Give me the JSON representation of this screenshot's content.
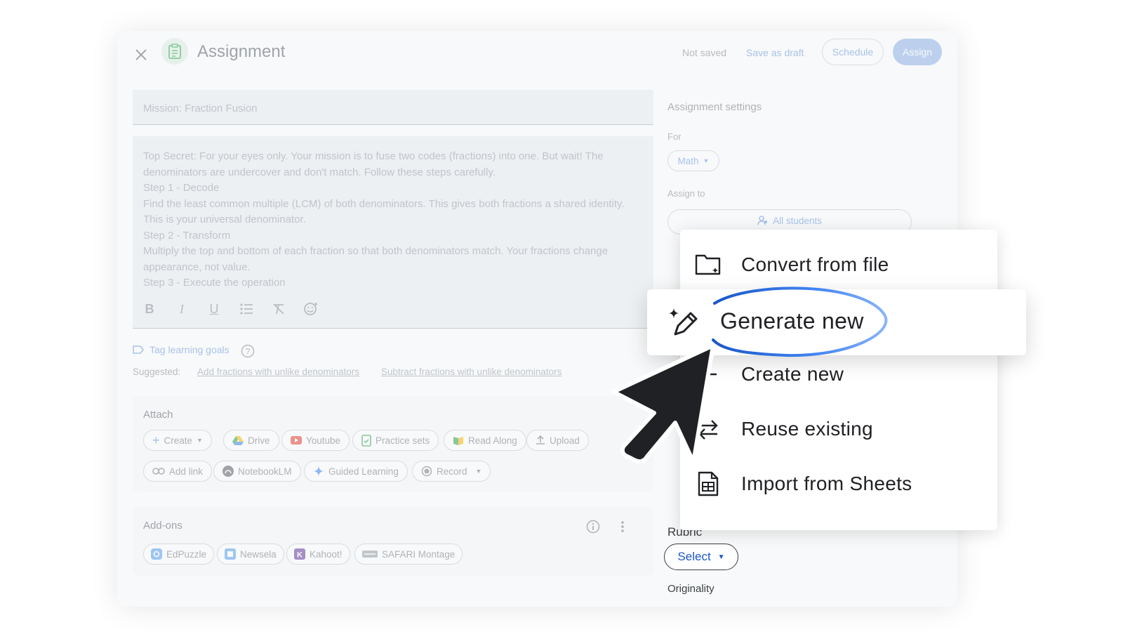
{
  "header": {
    "title": "Assignment",
    "status": "Not saved",
    "save_draft": "Save as draft",
    "schedule": "Schedule",
    "assign": "Assign"
  },
  "form": {
    "title_value": "Mission: Fraction Fusion",
    "description_lines": [
      "Top Secret: For your eyes only. Your mission is to fuse two codes (fractions) into one. But wait! The",
      "denominators are undercover and don't match. Follow these steps carefully.",
      "Step 1 - Decode",
      "Find the least common multiple (LCM) of both denominators. This gives both fractions a shared identity.",
      "This is your universal denominator.",
      "Step 2 - Transform",
      "Multiply the top and bottom of each fraction so that both denominators match. Your fractions change",
      "appearance, not value.",
      "Step 3 - Execute the operation"
    ],
    "toolbar": [
      "bold-icon",
      "italic-icon",
      "underline-icon",
      "bulleted-list-icon",
      "clear-format-icon",
      "emoji-icon"
    ]
  },
  "learning_goals": {
    "tag_label": "Tag learning goals",
    "suggested_label": "Suggested:",
    "suggestions": [
      "Add fractions with unlike denominators",
      "Subtract fractions with unlike denominators"
    ]
  },
  "attach": {
    "title": "Attach",
    "chips": [
      "Create",
      "Drive",
      "Youtube",
      "Practice sets",
      "Read Along",
      "Upload",
      "Add link",
      "NotebookLM",
      "Guided Learning",
      "Record"
    ]
  },
  "addons": {
    "title": "Add-ons",
    "chips": [
      "EdPuzzle",
      "Newsela",
      "Kahoot!",
      "SAFARI Montage"
    ]
  },
  "settings": {
    "title": "Assignment settings",
    "for_label": "For",
    "for_value": "Math",
    "assign_to_label": "Assign to",
    "assign_to_value": "All students",
    "rubric_label": "Rubric",
    "rubric_select": "Select",
    "originality_label": "Originality"
  },
  "rubric_menu": {
    "items": [
      "Convert from file",
      "Generate new",
      "Create new",
      "Reuse existing",
      "Import from Sheets"
    ],
    "highlighted": "Generate new"
  },
  "colors": {
    "accent_blue": "#1a73e8",
    "assign_button": "#93b5ea",
    "ring_blue": "#4285f4"
  }
}
